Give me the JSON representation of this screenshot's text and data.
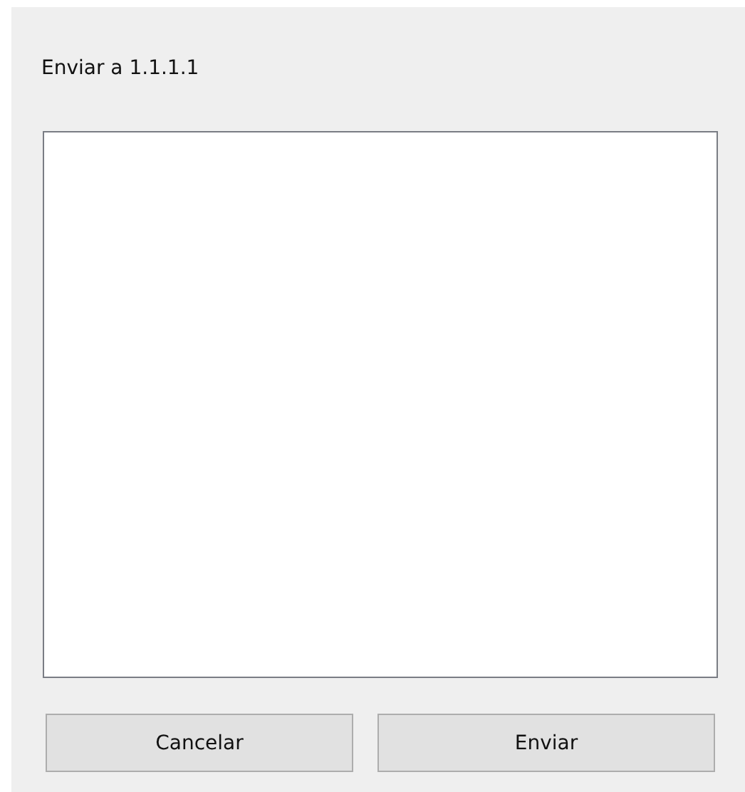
{
  "dialog": {
    "title": "Enviar a 1.1.1.1"
  },
  "buttons": [
    {
      "label": "Cancelar"
    },
    {
      "label": "Enviar"
    }
  ]
}
